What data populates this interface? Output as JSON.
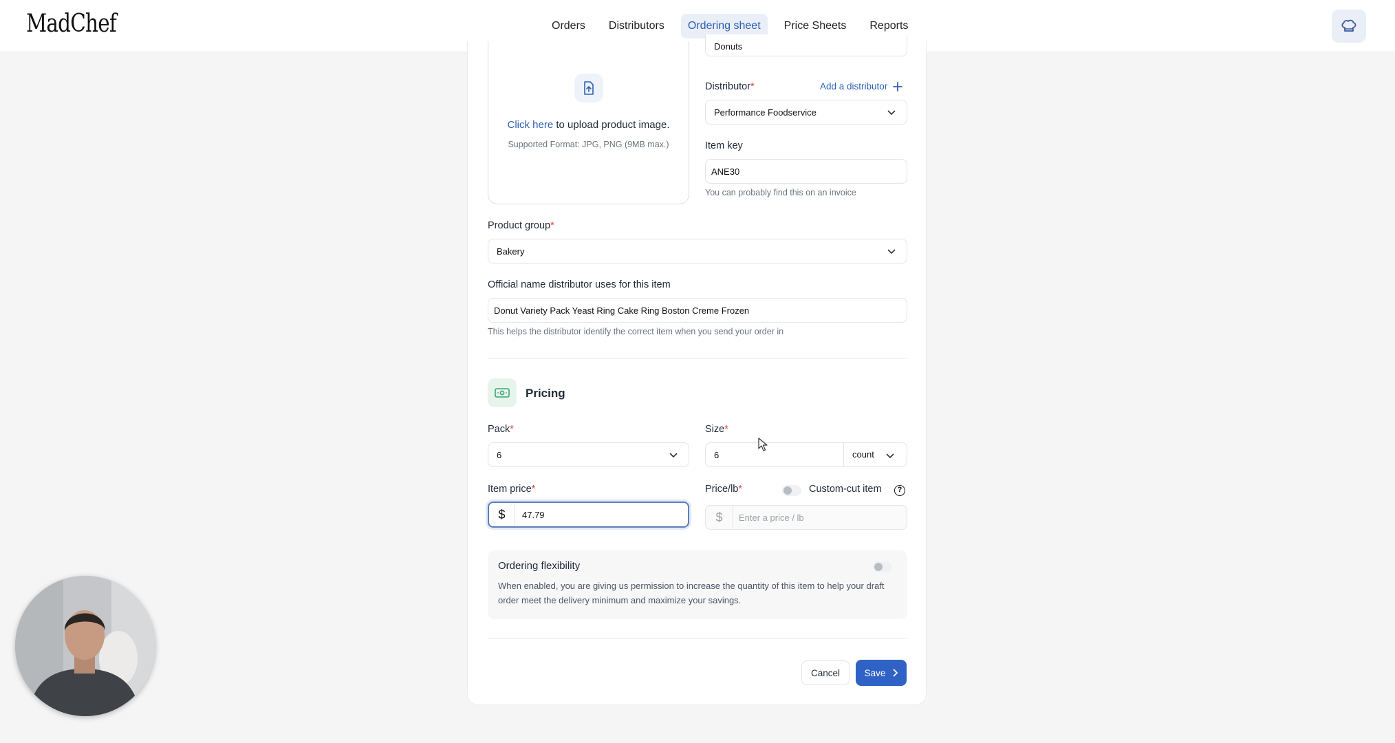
{
  "app": {
    "logo": "MadChef"
  },
  "nav": {
    "items": [
      {
        "label": "Orders"
      },
      {
        "label": "Distributors"
      },
      {
        "label": "Ordering sheet"
      },
      {
        "label": "Price Sheets"
      },
      {
        "label": "Reports"
      }
    ],
    "active": "Ordering sheet"
  },
  "form": {
    "name_value": "Donuts",
    "upload": {
      "link": "Click here",
      "text": " to upload product image.",
      "hint": "Supported Format: JPG, PNG (9MB max.)"
    },
    "distributor": {
      "label": "Distributor",
      "add_label": "Add a distributor",
      "value": "Performance Foodservice"
    },
    "item_key": {
      "label": "Item key",
      "value": "ANE30",
      "hint": "You can probably find this on an invoice"
    },
    "product_group": {
      "label": "Product group",
      "value": "Bakery"
    },
    "official_name": {
      "label": "Official name distributor uses for this item",
      "value": "Donut Variety Pack Yeast Ring Cake Ring Boston Creme Frozen",
      "hint": "This helps the distributor identify the correct item when you send your order in"
    },
    "pricing": {
      "title": "Pricing",
      "pack": {
        "label": "Pack",
        "value": "6"
      },
      "size": {
        "label": "Size",
        "value": "6",
        "unit": "count"
      },
      "item_price": {
        "label": "Item price",
        "currency": "$",
        "value": "47.79"
      },
      "price_lb": {
        "label": "Price/lb",
        "currency": "$",
        "placeholder": "Enter a price / lb"
      },
      "custom_cut": {
        "label": "Custom-cut item",
        "enabled": false
      },
      "required_mark": "*"
    },
    "ordering_flexibility": {
      "title": "Ordering flexibility",
      "description": "When enabled, you are giving us permission to increase the quantity of this item to help your draft order meet the delivery minimum and maximize your savings.",
      "enabled": false
    },
    "actions": {
      "cancel": "Cancel",
      "save": "Save"
    }
  },
  "colors": {
    "accent": "#2f62c4",
    "active_nav_bg": "#e9eef7",
    "required": "#e0433a",
    "pricing_icon": "#3aa76d"
  },
  "icons": [
    "chef-hat-icon",
    "upload-icon",
    "plus-icon",
    "chevron-down-icon",
    "money-icon",
    "help-icon",
    "chevron-right-icon"
  ]
}
